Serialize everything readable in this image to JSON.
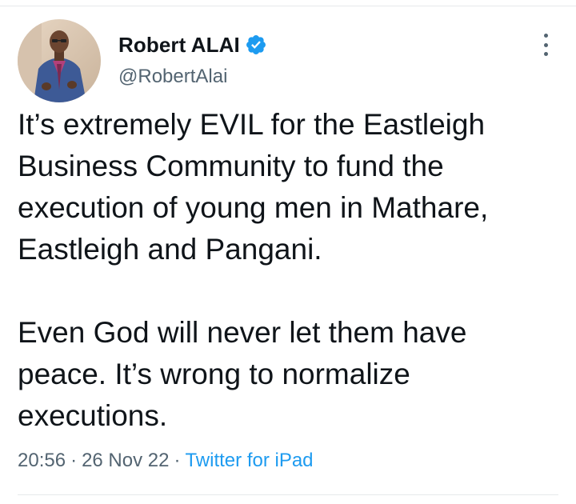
{
  "tweet": {
    "author": {
      "name": "Robert ALAI",
      "handle": "@RobertAlai",
      "verified_icon": "verified-badge-icon",
      "verified_color": "#1d9bf0"
    },
    "more_icon": "more-vertical-icon",
    "paragraphs": [
      "It’s extremely EVIL for the Eastleigh Business Community to fund the execution of young men in Mathare, Eastleigh and Pangani.",
      "Even God will never let them have peace. It’s wrong to normalize executions."
    ],
    "time": "20:56",
    "date": "26 Nov 22",
    "separator": "·",
    "source": "Twitter for iPad",
    "colors": {
      "text": "#0f1419",
      "secondary": "#536471",
      "link": "#1d9bf0"
    }
  }
}
